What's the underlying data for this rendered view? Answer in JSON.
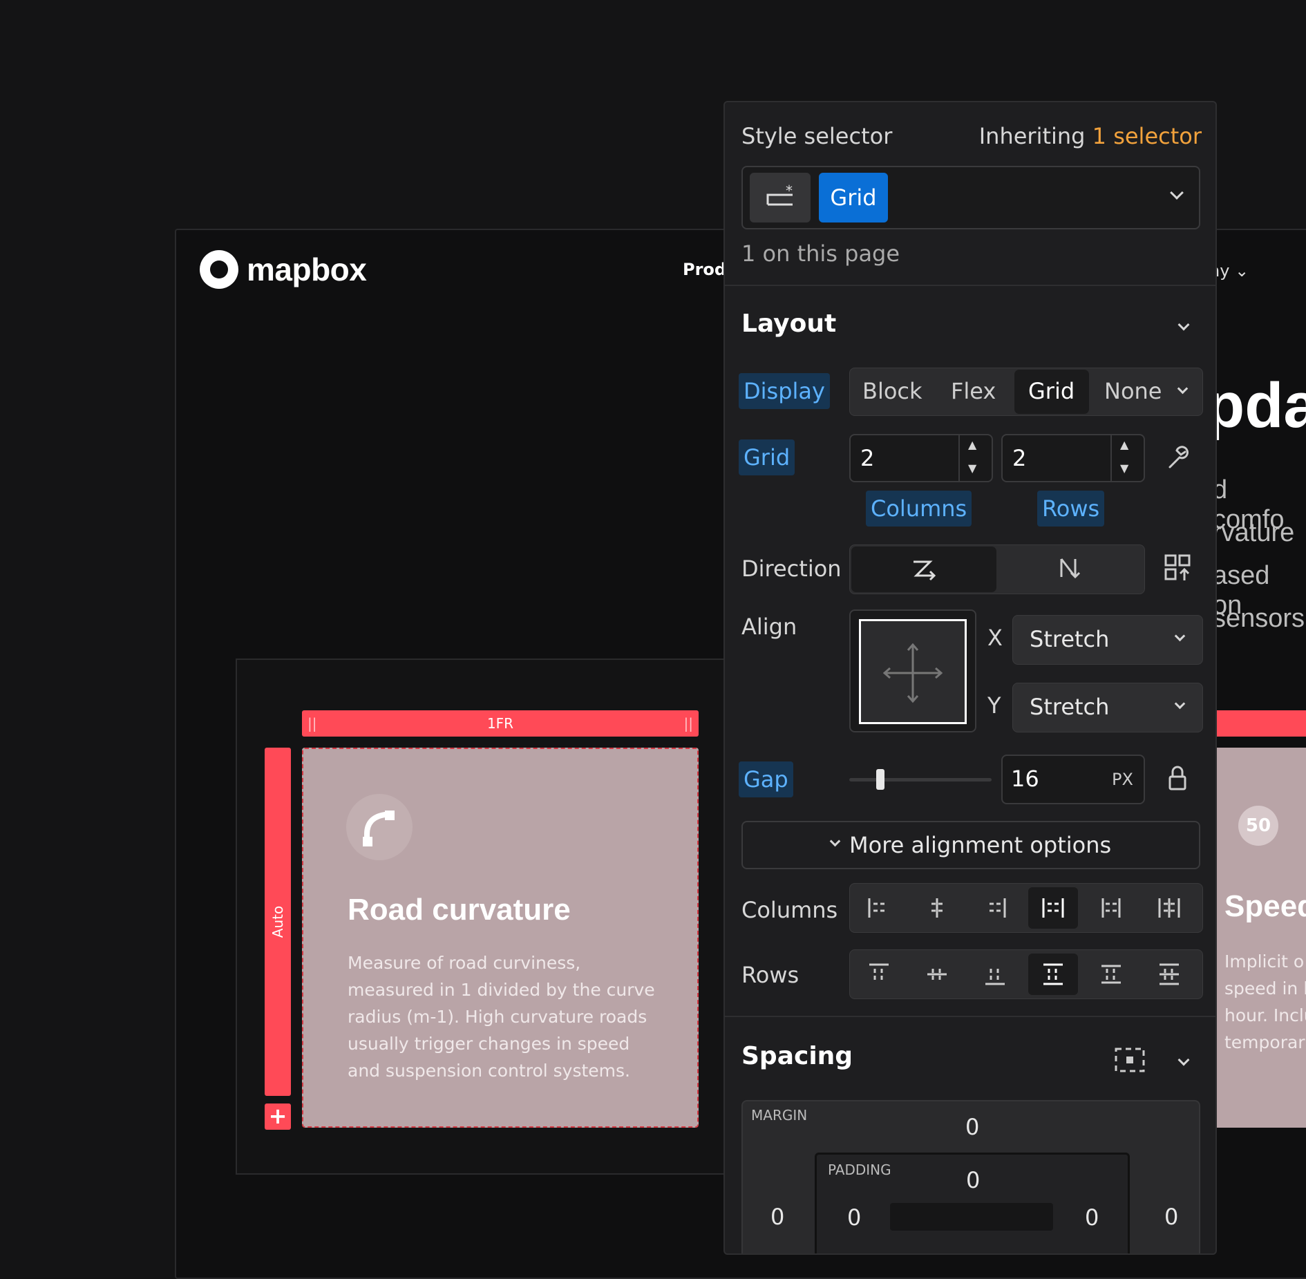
{
  "site": {
    "brand": "mapbox",
    "nav_left": "Prod",
    "nav_right": "ny",
    "headline_fragment": "pda",
    "body_fragments": [
      "d comfo",
      "rvature",
      "ased on",
      "sensors"
    ]
  },
  "grid_overlay": {
    "column_track": "1FR",
    "row_track": "Auto",
    "add_row": "+"
  },
  "cards": [
    {
      "icon": "curve-icon",
      "title": "Road curvature",
      "text": "Measure of road curviness, measured in 1 divided by the curve radius (m-1). High curvature roads usually trigger changes in speed and suspension control systems."
    },
    {
      "badge": "50",
      "title": "Speed",
      "lines": [
        "Implicit o",
        "speed in l",
        "hour. Inclu",
        "temporar"
      ]
    }
  ],
  "panel": {
    "header": {
      "title": "Style selector",
      "inheriting_prefix": "Inheriting",
      "inheriting_link": "1 selector",
      "selector_tag": "Grid",
      "count": "1 on this page"
    },
    "layout": {
      "title": "Layout",
      "display_label": "Display",
      "display_options": [
        "Block",
        "Flex",
        "Grid",
        "None"
      ],
      "display_selected": "Grid",
      "grid_label": "Grid",
      "columns_value": "2",
      "rows_value": "2",
      "columns_label": "Columns",
      "rows_label": "Rows",
      "direction_label": "Direction",
      "align_label": "Align",
      "align_x_label": "X",
      "align_x_value": "Stretch",
      "align_y_label": "Y",
      "align_y_value": "Stretch",
      "gap_label": "Gap",
      "gap_value": "16",
      "gap_unit": "PX",
      "gap_slider_fraction": 0.2,
      "more_options": "More alignment options",
      "columns_row_label": "Columns",
      "rows_row_label": "Rows",
      "columns_selected_index": 3,
      "rows_selected_index": 3
    },
    "spacing": {
      "title": "Spacing",
      "margin_label": "MARGIN",
      "margin_top": "0",
      "margin_left": "0",
      "margin_right": "0",
      "padding_label": "PADDING",
      "padding_top": "0",
      "padding_left": "0",
      "padding_right": "0"
    }
  },
  "colors": {
    "accent_blue": "#0a6fd6",
    "tag_blue": "#5db2ff",
    "orange": "#f2a23c",
    "grid_red": "#ff4a57",
    "card_pink": "#b9a4a7"
  }
}
